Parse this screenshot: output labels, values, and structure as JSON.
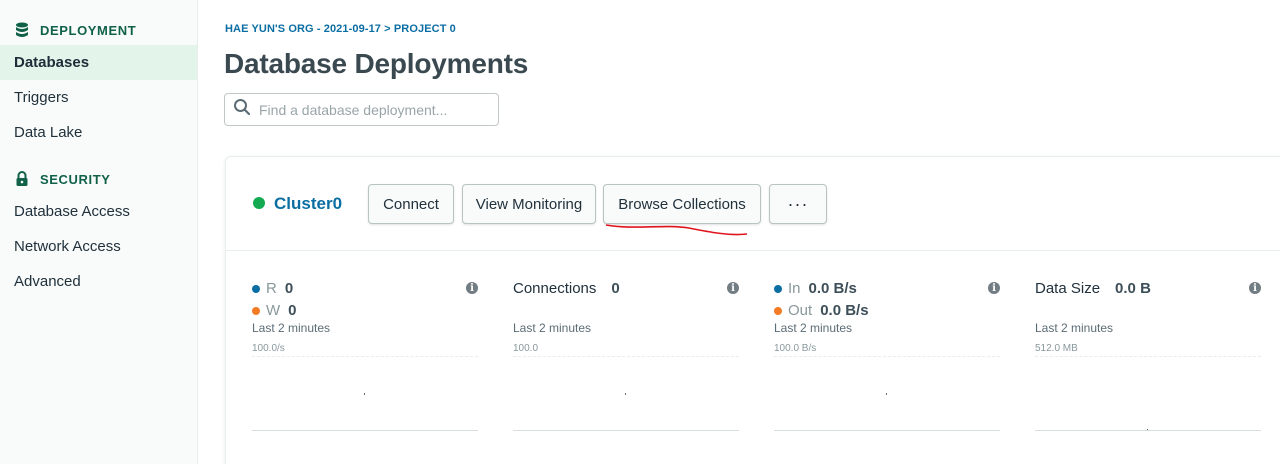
{
  "sidebar": {
    "sections": [
      {
        "title": "DEPLOYMENT",
        "icon": "database-icon",
        "items": [
          {
            "label": "Databases",
            "active": true
          },
          {
            "label": "Triggers",
            "active": false
          },
          {
            "label": "Data Lake",
            "active": false
          }
        ]
      },
      {
        "title": "SECURITY",
        "icon": "lock-icon",
        "items": [
          {
            "label": "Database Access",
            "active": false
          },
          {
            "label": "Network Access",
            "active": false
          },
          {
            "label": "Advanced",
            "active": false
          }
        ]
      }
    ]
  },
  "breadcrumb": {
    "org": "HAE YUN'S ORG - 2021-09-17",
    "separator": ">",
    "project": "PROJECT 0"
  },
  "page_title": "Database Deployments",
  "search": {
    "placeholder": "Find a database deployment...",
    "value": ""
  },
  "cluster": {
    "name": "Cluster0",
    "status_color": "#13aa52",
    "buttons": {
      "connect": "Connect",
      "view_monitoring": "View Monitoring",
      "browse_collections": "Browse Collections",
      "more": "···"
    }
  },
  "metrics": {
    "ops": {
      "r_label": "R",
      "r_value": "0",
      "w_label": "W",
      "w_value": "0",
      "period": "Last 2 minutes",
      "scale": "100.0/s"
    },
    "connections": {
      "label": "Connections",
      "value": "0",
      "period": "Last 2 minutes",
      "scale": "100.0"
    },
    "network": {
      "in_label": "In",
      "in_value": "0.0 B/s",
      "out_label": "Out",
      "out_value": "0.0 B/s",
      "period": "Last 2 minutes",
      "scale": "100.0 B/s"
    },
    "data_size": {
      "label": "Data Size",
      "value": "0.0 B",
      "period": "Last 2 minutes",
      "scale": "512.0 MB"
    }
  },
  "colors": {
    "accent_green": "#116149",
    "link_blue": "#0b6ea3",
    "status_green": "#13aa52",
    "series_orange": "#f47a24",
    "annotation_red": "#e0141e"
  }
}
